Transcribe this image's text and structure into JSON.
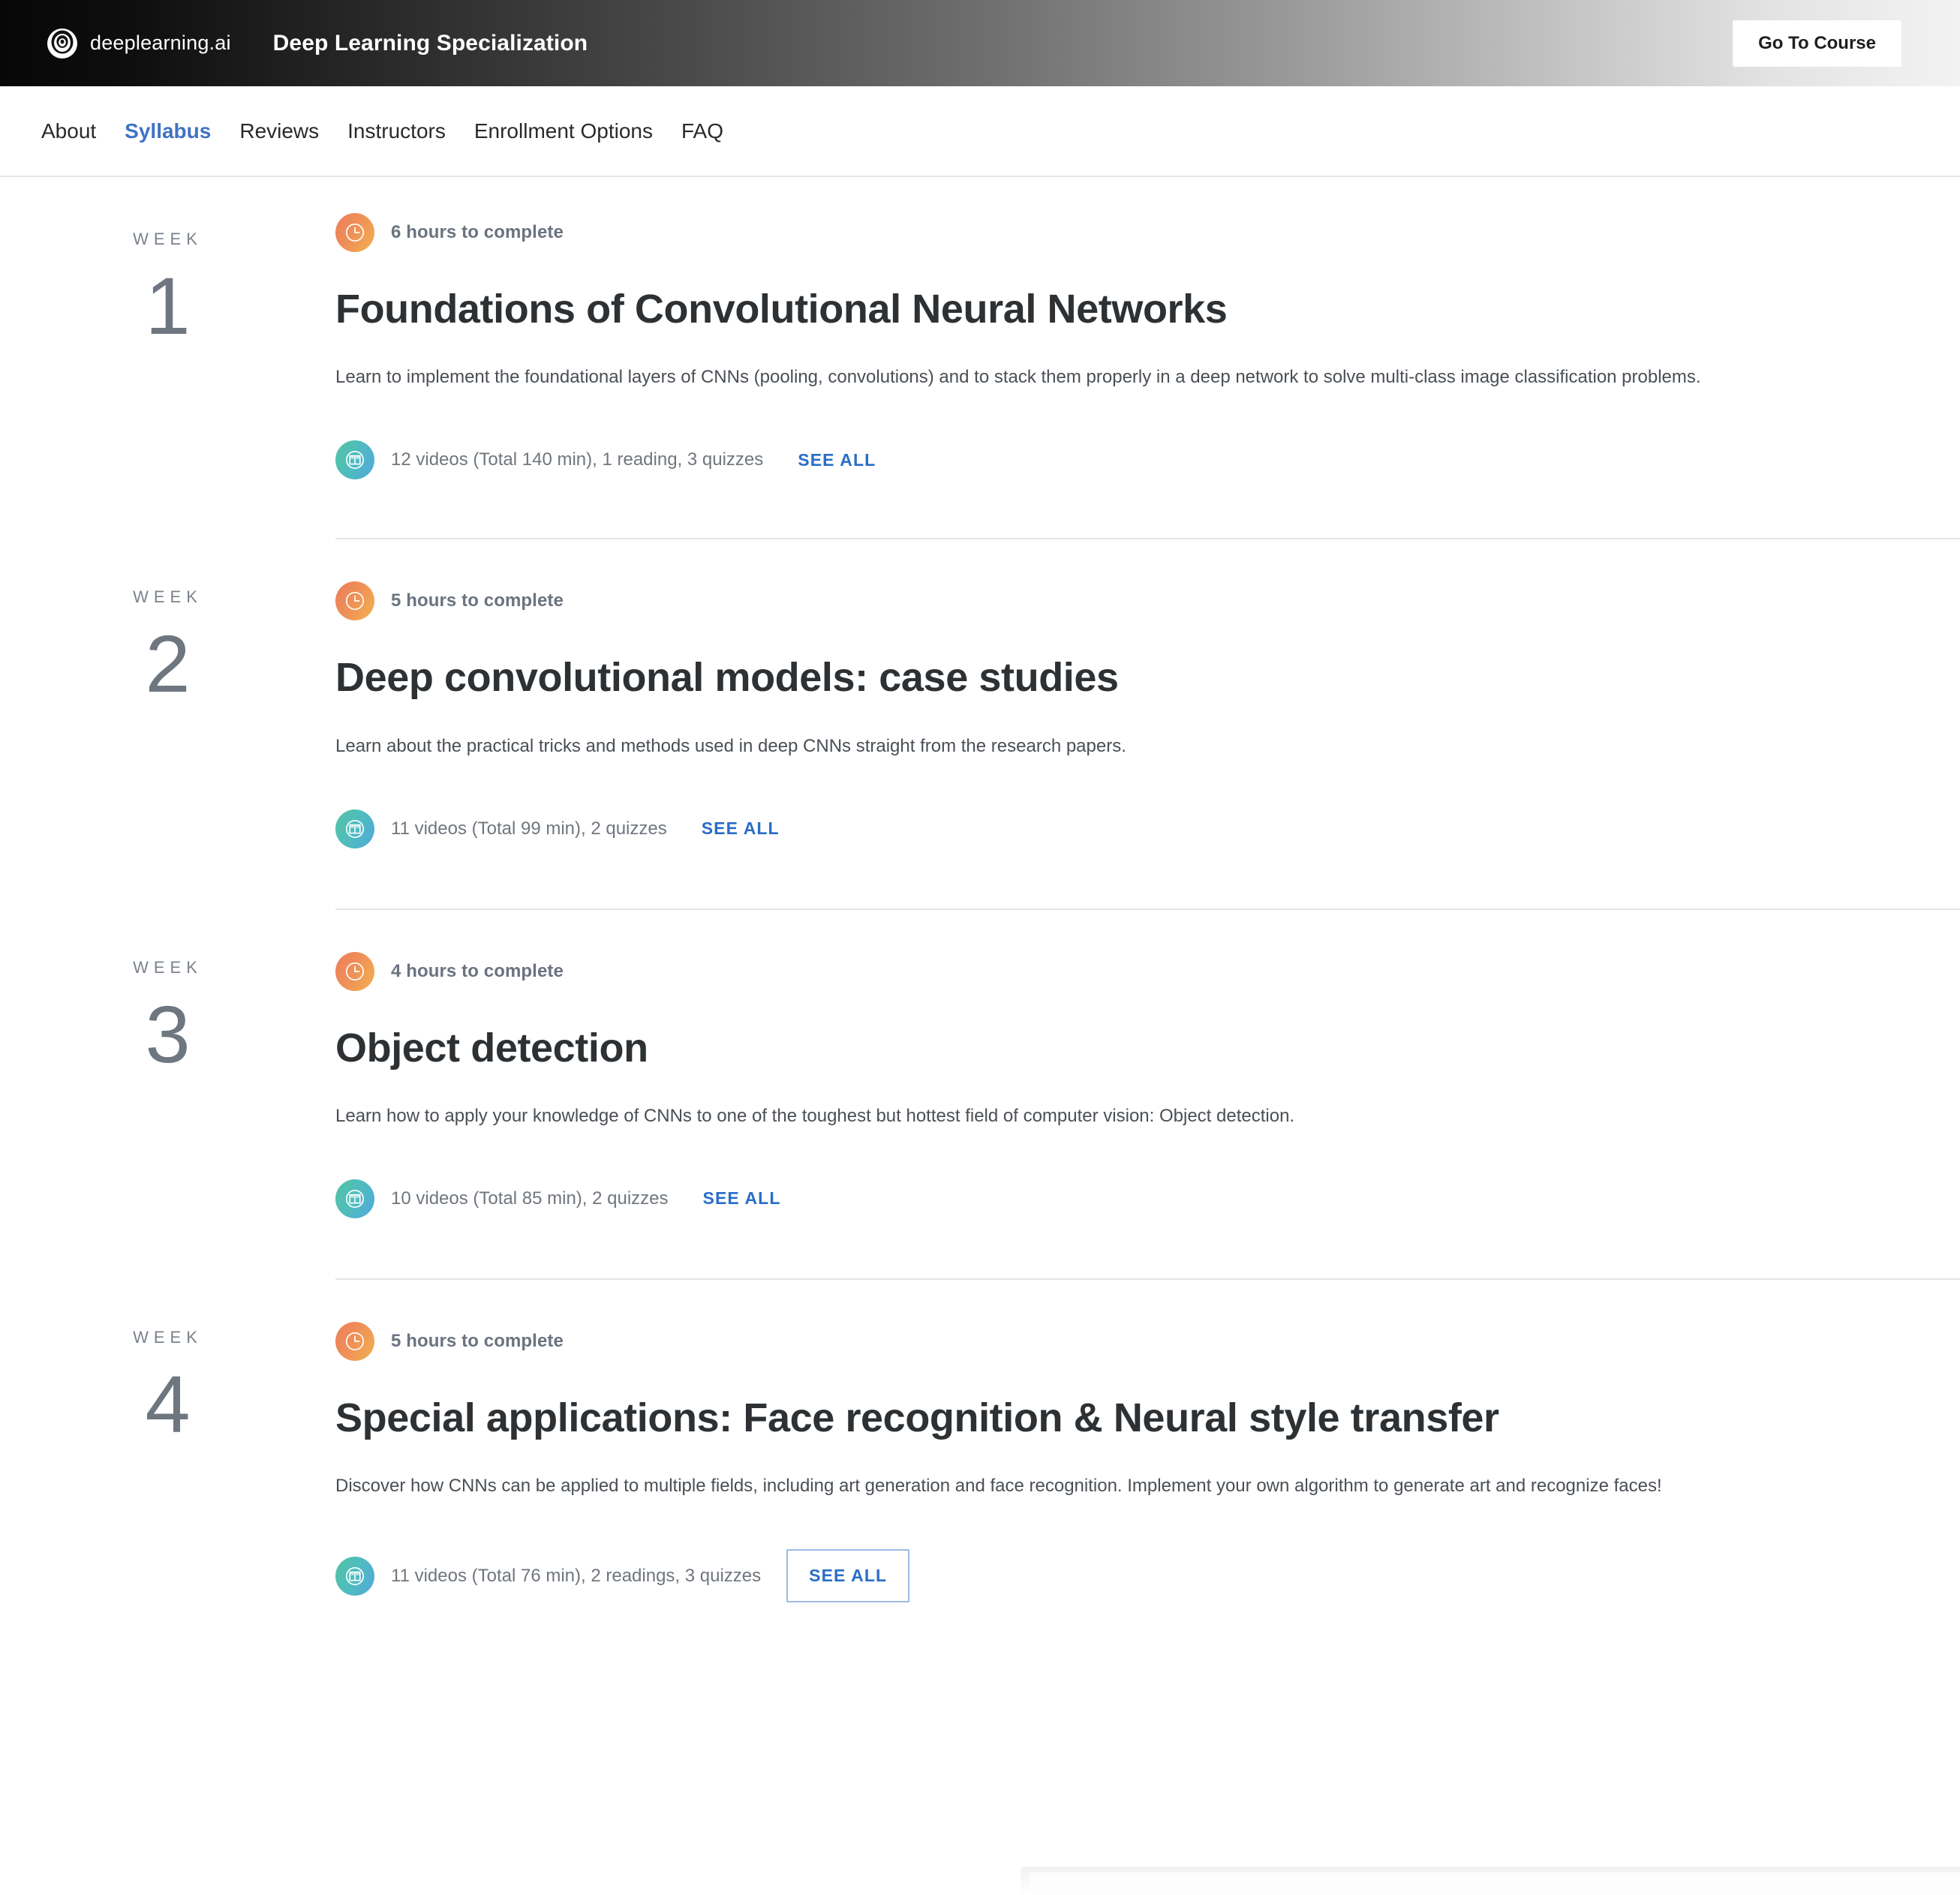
{
  "banner": {
    "brand_name": "deeplearning.ai",
    "logo_icon": "deeplearning-ai-logo-icon",
    "title": "Deep Learning Specialization",
    "cta_label": "Go To Course"
  },
  "nav": {
    "items": [
      {
        "label": "About",
        "active": false
      },
      {
        "label": "Syllabus",
        "active": true
      },
      {
        "label": "Reviews",
        "active": false
      },
      {
        "label": "Instructors",
        "active": false
      },
      {
        "label": "Enrollment Options",
        "active": false
      },
      {
        "label": "FAQ",
        "active": false
      }
    ]
  },
  "syllabus": {
    "week_label": "WEEK",
    "see_all_label": "SEE ALL",
    "weeks": [
      {
        "number": "1",
        "duration": "6 hours to complete",
        "title": "Foundations of Convolutional Neural Networks",
        "description": "Learn to implement the foundational layers of CNNs (pooling, convolutions) and to stack them properly in a deep network to solve multi-class image classification problems.",
        "content": "12 videos (Total 140 min), 1 reading, 3 quizzes",
        "see_all_focused": false
      },
      {
        "number": "2",
        "duration": "5 hours to complete",
        "title": "Deep convolutional models: case studies",
        "description": "Learn about the practical tricks and methods used in deep CNNs straight from the research papers.",
        "content": "11 videos (Total 99 min), 2 quizzes",
        "see_all_focused": false
      },
      {
        "number": "3",
        "duration": "4 hours to complete",
        "title": "Object detection",
        "description": "Learn how to apply your knowledge of CNNs to one of the toughest but hottest field of computer vision: Object detection.",
        "content": "10 videos (Total 85 min), 2 quizzes",
        "see_all_focused": false
      },
      {
        "number": "4",
        "duration": "5 hours to complete",
        "title": "Special applications: Face recognition & Neural style transfer",
        "description": "Discover how CNNs can be applied to multiple fields, including art generation and face recognition. Implement your own algorithm to generate art and recognize faces!",
        "content": "11 videos (Total 76 min), 2 readings, 3 quizzes",
        "see_all_focused": true
      }
    ]
  },
  "colors": {
    "accent_link": "#2a6dc7",
    "nav_active": "#3f72c4",
    "clock_icon_gradient_start": "#ec7d5a",
    "clock_icon_gradient_end": "#f2b24f",
    "book_icon_gradient_start": "#54c3a4",
    "book_icon_gradient_end": "#52a9dd",
    "heading": "#2d3134",
    "muted_text": "#70767e"
  }
}
